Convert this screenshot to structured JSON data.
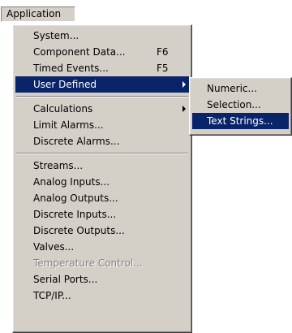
{
  "menubar": {
    "application_label": "Application"
  },
  "main_menu": {
    "items": [
      {
        "label": "System...",
        "shortcut": ""
      },
      {
        "label": "Component Data...",
        "shortcut": "F6"
      },
      {
        "label": "Timed Events...",
        "shortcut": "F5"
      },
      {
        "label": "User Defined",
        "shortcut": "",
        "submenu": true,
        "highlighted": true
      },
      {
        "label": "Calculations",
        "shortcut": "",
        "submenu": true
      },
      {
        "label": "Limit Alarms...",
        "shortcut": ""
      },
      {
        "label": "Discrete Alarms...",
        "shortcut": ""
      },
      {
        "label": "Streams...",
        "shortcut": ""
      },
      {
        "label": "Analog Inputs...",
        "shortcut": ""
      },
      {
        "label": "Analog Outputs...",
        "shortcut": ""
      },
      {
        "label": "Discrete Inputs...",
        "shortcut": ""
      },
      {
        "label": "Discrete Outputs...",
        "shortcut": ""
      },
      {
        "label": "Valves...",
        "shortcut": ""
      },
      {
        "label": "Temperature Control...",
        "shortcut": "",
        "disabled": true
      },
      {
        "label": "Serial Ports...",
        "shortcut": ""
      },
      {
        "label": "TCP/IP...",
        "shortcut": ""
      }
    ]
  },
  "user_defined_submenu": {
    "items": [
      {
        "label": "Numeric..."
      },
      {
        "label": "Selection..."
      },
      {
        "label": "Text Strings...",
        "highlighted": true
      }
    ]
  },
  "colors": {
    "menu_background": "#d4d0c8",
    "highlight": "#0a246a",
    "highlight_text": "#ffffff",
    "disabled_text": "#808080"
  }
}
